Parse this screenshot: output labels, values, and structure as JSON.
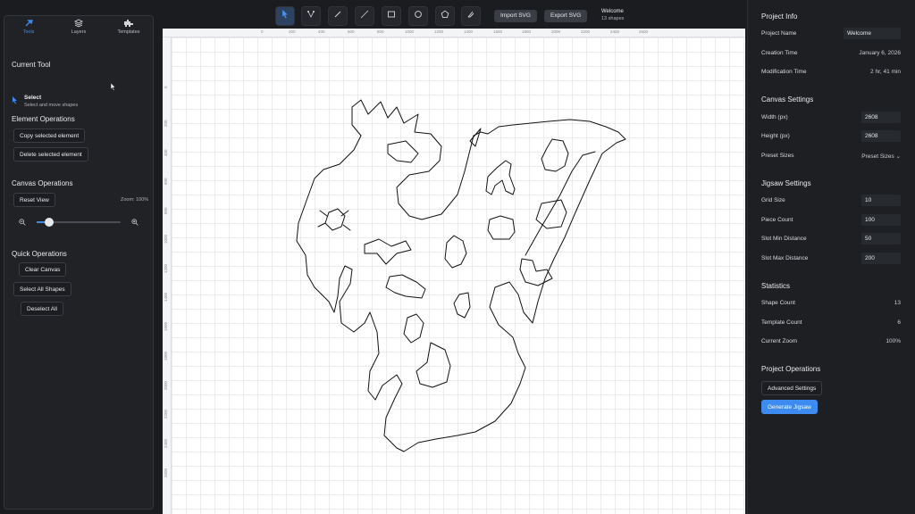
{
  "left": {
    "tabs": [
      {
        "label": "Tools",
        "icon": "hammer-icon"
      },
      {
        "label": "Layers",
        "icon": "layers-icon"
      },
      {
        "label": "Templates",
        "icon": "templates-icon"
      }
    ],
    "current_tool_title": "Current Tool",
    "tool_name": "Select",
    "tool_desc": "Select and move shapes",
    "element_ops_title": "Element Operations",
    "copy_btn": "Copy selected element",
    "delete_btn": "Delete selected element",
    "canvas_ops_title": "Canvas Operations",
    "reset_btn": "Reset View",
    "zoom_label": "Zoom: 100%",
    "zoom_level": 0.15,
    "quick_ops_title": "Quick Operations",
    "clear_btn": "Clear Canvas",
    "select_all_btn": "Select All Shapes",
    "deselect_btn": "Deselect All"
  },
  "toolbar": {
    "tools": [
      "select-tool-icon",
      "node-tool-icon",
      "line-tool-icon",
      "pen-tool-icon",
      "rectangle-tool-icon",
      "circle-tool-icon",
      "polygon-tool-icon",
      "brush-tool-icon"
    ],
    "import_label": "Import SVG",
    "export_label": "Export SVG",
    "project_name": "Welcome",
    "shape_count": "13 shapes"
  },
  "ruler": {
    "top": [
      "0",
      "200",
      "400",
      "600",
      "800",
      "1000",
      "1200",
      "1400",
      "1600",
      "1800",
      "2000",
      "2200",
      "2400",
      "2600"
    ],
    "left": [
      "0",
      "200",
      "400",
      "600",
      "800",
      "1000",
      "1200",
      "1400",
      "1600",
      "1800",
      "2000",
      "2200",
      "2400",
      "2600"
    ]
  },
  "right": {
    "project_info_title": "Project Info",
    "project_name_label": "Project Name",
    "project_name_value": "Welcome",
    "creation_label": "Creation Time",
    "creation_value": "January 6, 2026",
    "modification_label": "Modification Time",
    "modification_value": "2 hr, 41 min",
    "canvas_settings_title": "Canvas Settings",
    "width_label": "Width (px)",
    "width_value": "2608",
    "height_label": "Height (px)",
    "height_value": "2608",
    "preset_label": "Preset Sizes",
    "preset_value": "Preset Sizes ⌄",
    "jigsaw_title": "Jigsaw Settings",
    "grid_label": "Grid Size",
    "grid_value": "10",
    "piece_label": "Piece Count",
    "piece_value": "100",
    "slot_min_label": "Slot Min Distance",
    "slot_min_value": "50",
    "slot_max_label": "Slot Max Distance",
    "slot_max_value": "200",
    "stats_title": "Statistics",
    "shape_count_label": "Shape Count",
    "shape_count_value": "13",
    "template_count_label": "Template Count",
    "template_count_value": "6",
    "zoom_label": "Current Zoom",
    "zoom_value": "100%",
    "project_ops_title": "Project Operations",
    "advanced_btn": "Advanced Settings",
    "generate_btn": "Generate Jigsaw"
  },
  "colors": {
    "accent": "#3d8bf0",
    "panel": "#202226",
    "canvas": "#ffffff"
  }
}
